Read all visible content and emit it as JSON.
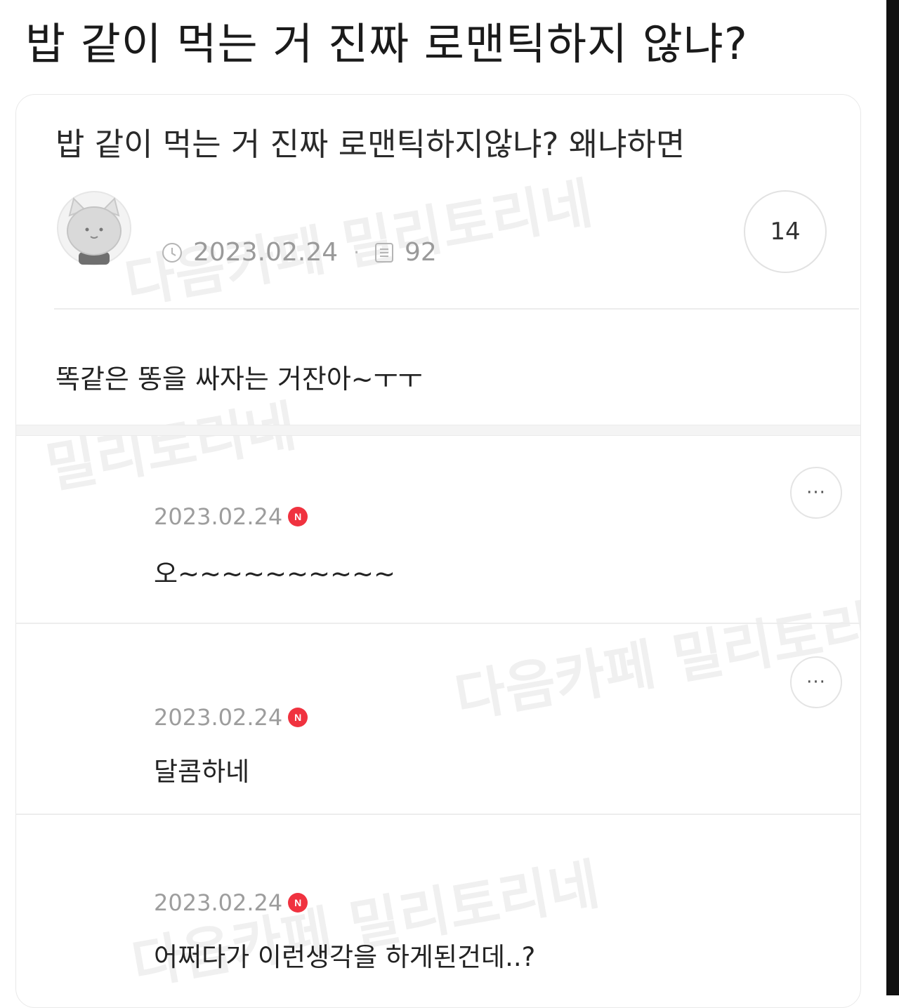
{
  "page_title": "밥 같이 먹는 거 진짜 로맨틱하지 않냐?",
  "post": {
    "heading": "밥 같이 먹는 거 진짜 로맨틱하지않냐? 왜냐하면",
    "date": "2023.02.24",
    "views": "92",
    "comment_count": "14",
    "body": "똑같은 똥을 싸자는 거잔아~ㅜㅜ"
  },
  "comments": [
    {
      "date": "2023.02.24",
      "badge": "N",
      "text": "오~~~~~~~~~~",
      "more_label": "···"
    },
    {
      "date": "2023.02.24",
      "badge": "N",
      "text": "달콤하네",
      "more_label": "···"
    },
    {
      "date": "2023.02.24",
      "badge": "N",
      "text": "어쩌다가 이런생각을 하게된건데..?"
    }
  ],
  "watermarks": [
    "다음카페 밀리토리네",
    "다음카페 밀리토리네",
    "밀리토리네",
    "다음카페 밀리토리네"
  ],
  "colors": {
    "new_badge": "#f0323f",
    "meta_text": "#9a9a9a",
    "border": "#e9e9e9"
  },
  "icons": {
    "clock": "clock-icon",
    "views": "document-icon",
    "more": "more-dots-icon",
    "avatar": "cat-avatar-icon"
  }
}
